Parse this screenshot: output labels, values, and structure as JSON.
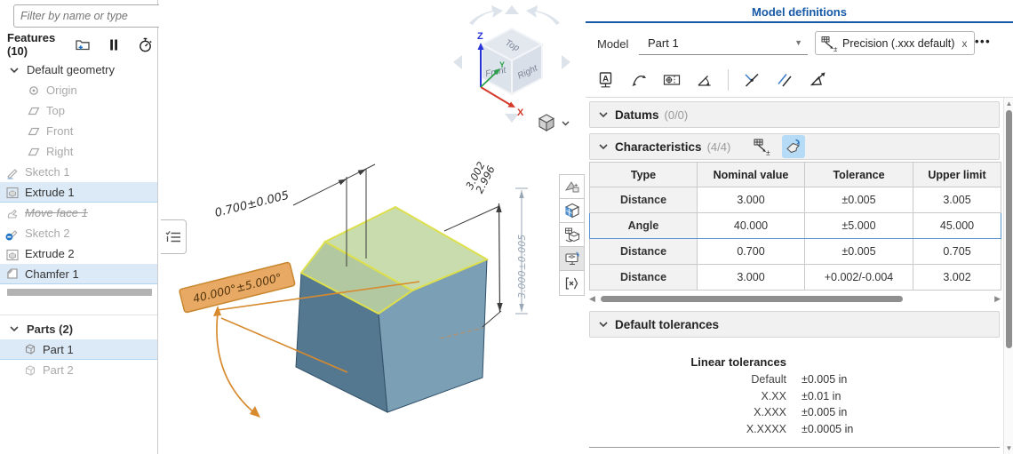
{
  "accent_color": "#1659a7",
  "highlight_green": "#c9dcae",
  "edge_yellow": "#dde04c",
  "selection_orange": "#d78a2e",
  "sidebar": {
    "filter_placeholder": "Filter by name or type",
    "features": {
      "header": "Features (10)",
      "items": [
        {
          "label": "Default geometry"
        },
        {
          "label": "Origin"
        },
        {
          "label": "Top"
        },
        {
          "label": "Front"
        },
        {
          "label": "Right"
        },
        {
          "label": "Sketch 1"
        },
        {
          "label": "Extrude 1"
        },
        {
          "label": "Move face 1"
        },
        {
          "label": "Sketch 2"
        },
        {
          "label": "Extrude 2"
        },
        {
          "label": "Chamfer 1"
        }
      ]
    },
    "parts": {
      "header": "Parts (2)",
      "items": [
        {
          "label": "Part 1"
        },
        {
          "label": "Part 2"
        }
      ]
    }
  },
  "viewport": {
    "view_cube": {
      "top": "Top",
      "front": "Front",
      "right": "Right",
      "axis_x": "X",
      "axis_y": "Y",
      "axis_z": "Z"
    },
    "dimensions": {
      "chamfer_width": "0.700±0.005",
      "height_upper": "3.002",
      "height_lower": "2.996",
      "height_nominal": "3.000±0.005",
      "angle": "40.000°±5.000°"
    }
  },
  "panel": {
    "title": "Model definitions",
    "model_label": "Model",
    "model_value": "Part 1",
    "precision_chip": "Precision (.xxx default)",
    "chip_close": "x",
    "menu_ellipsis": "•••",
    "sections": {
      "datums": {
        "title": "Datums",
        "count": "(0/0)"
      },
      "characteristics": {
        "title": "Characteristics",
        "count": "(4/4)"
      },
      "default_tolerances": {
        "title": "Default tolerances"
      }
    },
    "table": {
      "columns": [
        "Type",
        "Nominal value",
        "Tolerance",
        "Upper limit"
      ],
      "rows": [
        {
          "cells": [
            "Distance",
            "3.000",
            "±0.005",
            "3.005"
          ]
        },
        {
          "cells": [
            "Angle",
            "40.000",
            "±5.000",
            "45.000"
          ]
        },
        {
          "cells": [
            "Distance",
            "0.700",
            "±0.005",
            "0.705"
          ]
        },
        {
          "cells": [
            "Distance",
            "3.000",
            "+0.002/-0.004",
            "3.002"
          ]
        }
      ]
    },
    "linear_tolerances": {
      "title": "Linear tolerances",
      "rows": [
        {
          "label": "Default",
          "value": "±0.005 in"
        },
        {
          "label": "X.XX",
          "value": "±0.01 in"
        },
        {
          "label": "X.XXX",
          "value": "±0.005 in"
        },
        {
          "label": "X.XXXX",
          "value": "±0.0005 in"
        }
      ]
    }
  }
}
